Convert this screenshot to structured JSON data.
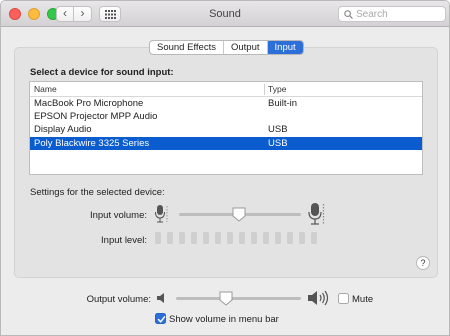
{
  "window": {
    "title": "Sound",
    "search_placeholder": "Search"
  },
  "nav": {
    "back_glyph": "‹",
    "forward_glyph": "›"
  },
  "tabs": [
    {
      "label": "Sound Effects",
      "active": false
    },
    {
      "label": "Output",
      "active": false
    },
    {
      "label": "Input",
      "active": true
    }
  ],
  "input": {
    "section_label": "Select a device for sound input:",
    "table": {
      "columns": [
        "Name",
        "Type"
      ],
      "rows": [
        {
          "name": "MacBook Pro Microphone",
          "type": "Built-in",
          "selected": false
        },
        {
          "name": "EPSON Projector MPP Audio",
          "type": "",
          "selected": false
        },
        {
          "name": "Display Audio",
          "type": "USB",
          "selected": false
        },
        {
          "name": "Poly Blackwire 3325 Series",
          "type": "USB",
          "selected": true
        }
      ]
    },
    "settings_label": "Settings for the selected device:",
    "input_volume_label": "Input volume:",
    "input_volume_level": 0.5,
    "input_level_label": "Input level:",
    "input_level_segments_active": 0
  },
  "help_glyph": "?",
  "output": {
    "volume_label": "Output volume:",
    "volume_level": 0.5,
    "mute_label": "Mute",
    "mute_checked": false,
    "show_volume_label": "Show volume in menu bar",
    "show_volume_checked": true
  },
  "colors": {
    "accent": "#2d6fd9",
    "selection": "#0a5ccf"
  },
  "icons": [
    "back-arrow-icon",
    "forward-arrow-icon",
    "grid-icon",
    "search-icon",
    "microphone-low-icon",
    "microphone-high-icon",
    "speaker-low-icon",
    "speaker-high-icon",
    "checkmark-icon",
    "help-icon"
  ]
}
